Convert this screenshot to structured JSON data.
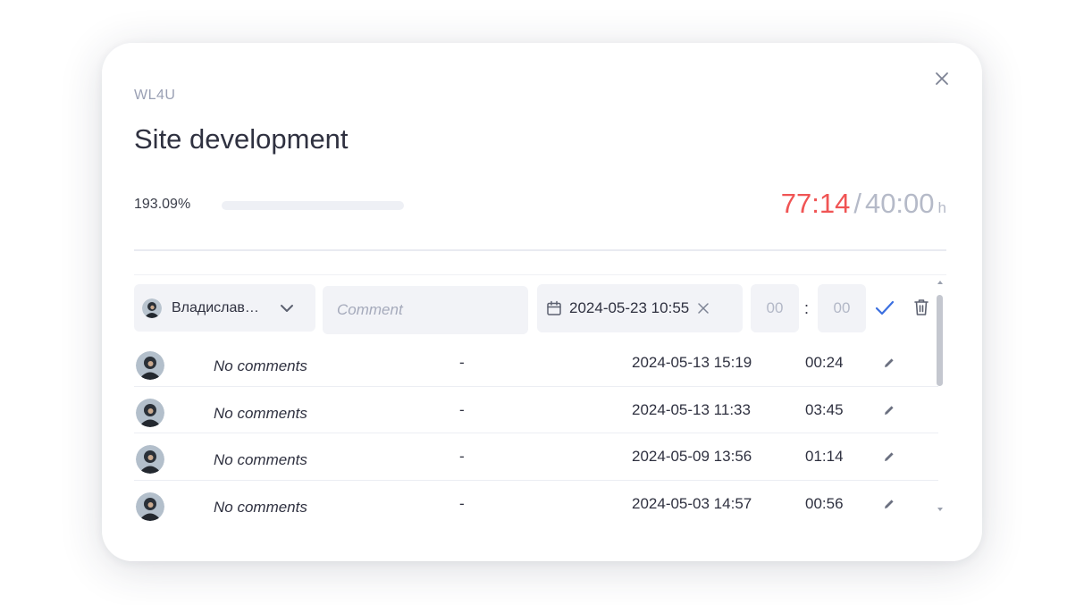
{
  "project": {
    "code": "WL4U"
  },
  "task": {
    "title": "Site development"
  },
  "progress": {
    "percent_label": "193.09%",
    "percent_value": 193.09,
    "spent": "77:14",
    "separator": "/",
    "planned": "40:00",
    "unit": "h",
    "spent_color": "#f05454"
  },
  "form": {
    "user_name": "Владислав…",
    "comment_placeholder": "Comment",
    "datetime": "2024-05-23 10:55",
    "hours_placeholder": "00",
    "minutes_placeholder": "00",
    "colon": ":",
    "confirm_color": "#3b6fe0"
  },
  "entries": [
    {
      "comment": "No comments",
      "tag": "-",
      "date": "2024-05-13 15:19",
      "duration": "00:24"
    },
    {
      "comment": "No comments",
      "tag": "-",
      "date": "2024-05-13 11:33",
      "duration": "03:45"
    },
    {
      "comment": "No comments",
      "tag": "-",
      "date": "2024-05-09 13:56",
      "duration": "01:14"
    },
    {
      "comment": "No comments",
      "tag": "-",
      "date": "2024-05-03 14:57",
      "duration": "00:56"
    }
  ],
  "icons": {
    "close": "close-icon",
    "avatar": "avatar-icon",
    "dropdown": "chevron-down-icon",
    "calendar": "calendar-icon",
    "clear": "clear-icon",
    "confirm": "check-icon",
    "delete": "trash-icon",
    "edit": "pencil-icon"
  }
}
